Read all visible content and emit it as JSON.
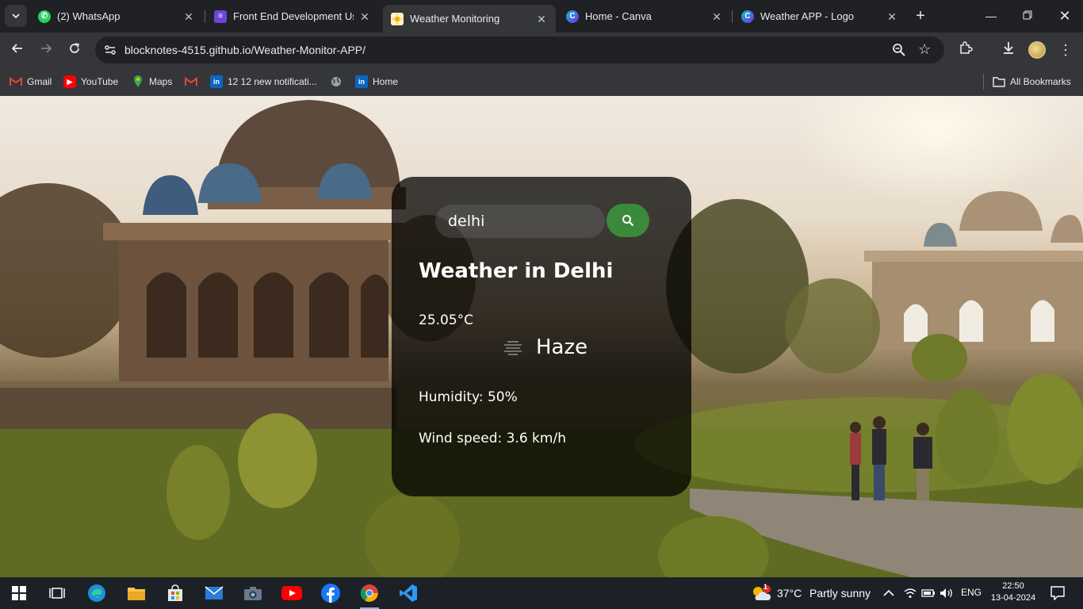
{
  "browser": {
    "tabs": [
      {
        "title": "(2) WhatsApp",
        "icon": "whatsapp-icon",
        "color": "#25d366"
      },
      {
        "title": "Front End Development Using",
        "icon": "list-icon",
        "color": "#6c45d9"
      },
      {
        "title": "Weather Monitoring",
        "icon": "sun-icon",
        "color": "#f4b400",
        "active": true
      },
      {
        "title": "Home - Canva",
        "icon": "canva-icon",
        "color": "#00c4cc"
      },
      {
        "title": "Weather APP - Logo",
        "icon": "canva-icon",
        "color": "#7d2ae8"
      }
    ],
    "url": "blocknotes-4515.github.io/Weather-Monitor-APP/",
    "bookmarks": [
      {
        "label": "Gmail",
        "icon": "gmail-icon"
      },
      {
        "label": "YouTube",
        "icon": "youtube-icon"
      },
      {
        "label": "Maps",
        "icon": "maps-icon"
      },
      {
        "label": "",
        "icon": "gmail-icon"
      },
      {
        "label": "12 12 new notificati...",
        "icon": "linkedin-icon"
      },
      {
        "label": "",
        "icon": "globe-icon"
      },
      {
        "label": "Home",
        "icon": "linkedin-icon"
      }
    ],
    "all_bookmarks": "All Bookmarks"
  },
  "weather": {
    "search_value": "delhi",
    "title": "Weather in Delhi",
    "temperature": "25.05°C",
    "condition": "Haze",
    "humidity": "Humidity: 50%",
    "wind": "Wind speed: 3.6 km/h",
    "accent": "#3b8a3b"
  },
  "taskbar": {
    "weather_temp": "37°C",
    "weather_text": "Partly sunny",
    "language": "ENG",
    "time": "22:50",
    "date": "13-04-2024",
    "weather_badge": "1"
  }
}
